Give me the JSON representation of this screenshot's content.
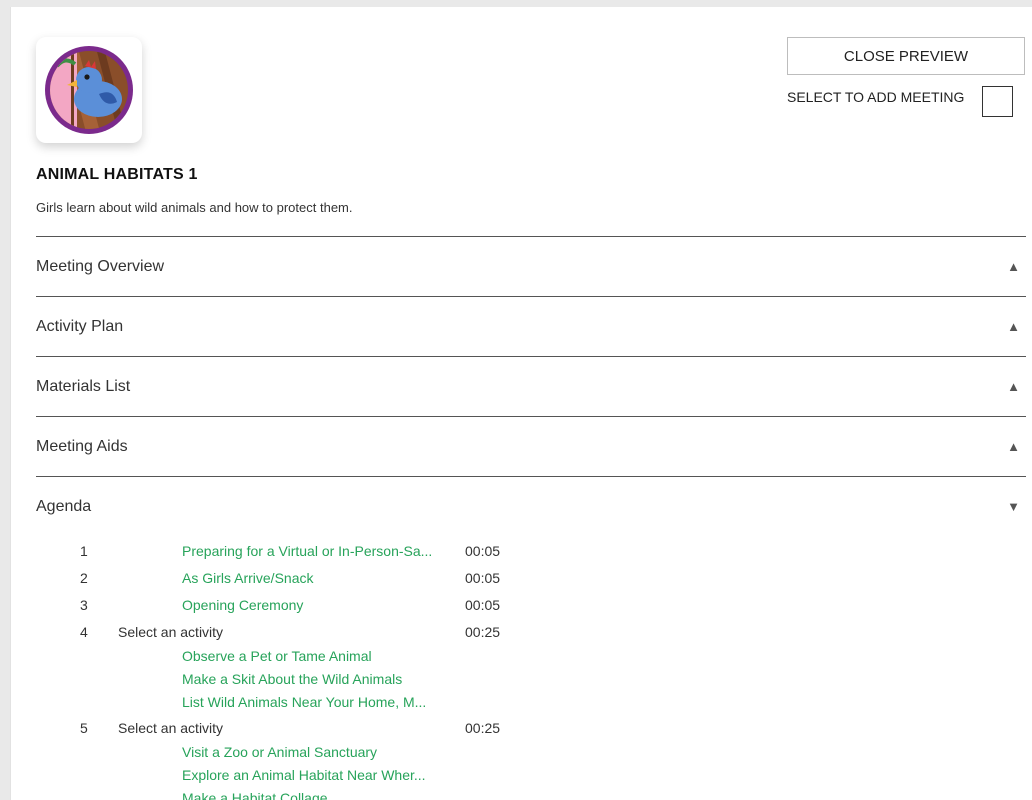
{
  "header": {
    "close_button": "CLOSE PREVIEW",
    "select_label": "SELECT TO ADD MEETING"
  },
  "meeting": {
    "title": "ANIMAL HABITATS 1",
    "description": "Girls learn about wild animals and how to protect them.",
    "logo_icon": "bird-badge-icon"
  },
  "sections": [
    {
      "label": "Meeting Overview",
      "state": "collapsed",
      "arrow": "▲"
    },
    {
      "label": "Activity Plan",
      "state": "collapsed",
      "arrow": "▲"
    },
    {
      "label": "Materials List",
      "state": "collapsed",
      "arrow": "▲"
    },
    {
      "label": "Meeting Aids",
      "state": "collapsed",
      "arrow": "▲"
    },
    {
      "label": "Agenda",
      "state": "expanded",
      "arrow": "▼"
    }
  ],
  "agenda": [
    {
      "num": "1",
      "title": "Preparing for a Virtual or In-Person-Sa...",
      "time": "00:05"
    },
    {
      "num": "2",
      "title": "As Girls Arrive/Snack",
      "time": "00:05"
    },
    {
      "num": "3",
      "title": "Opening Ceremony",
      "time": "00:05"
    },
    {
      "num": "4",
      "label": "Select an activity",
      "time": "00:25",
      "options": [
        "Observe a Pet or Tame Animal",
        "Make a Skit About the Wild Animals",
        "List Wild Animals Near Your Home, M..."
      ]
    },
    {
      "num": "5",
      "label": "Select an activity",
      "time": "00:25",
      "options": [
        "Visit a Zoo or Animal Sanctuary",
        "Explore an Animal Habitat Near Wher...",
        "Make a Habitat Collage"
      ]
    }
  ],
  "colors": {
    "link": "#27a35a",
    "badge_ring": "#7b2a8c",
    "bird_blue": "#5b8fd8",
    "wood": "#8a4e2a",
    "pink": "#f3a7c4"
  }
}
